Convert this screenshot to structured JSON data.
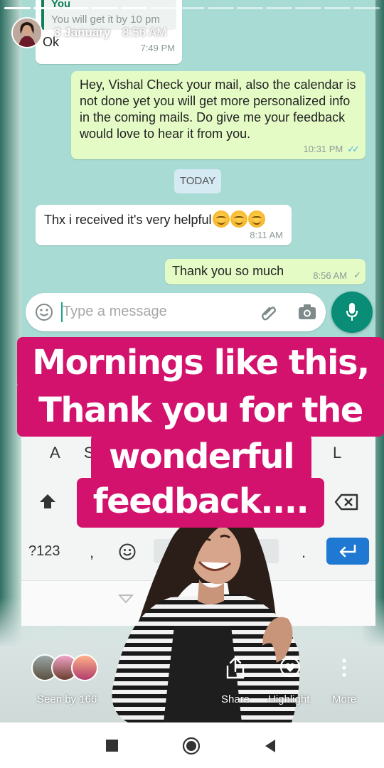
{
  "story": {
    "segments_total": 13,
    "segments_done": 5,
    "user_date": "3 January",
    "user_time": "8:56 AM"
  },
  "chat": {
    "top_sender": "You",
    "top_quote": "You will get it by 10 pm",
    "messages": [
      {
        "dir": "in",
        "text": "Ok",
        "time": "7:49 PM"
      },
      {
        "dir": "out",
        "text": "Hey, Vishal Check your mail, also the calendar is not done yet you will get more personalized info in the coming mails. Do give me your feedback would love to hear it from you.",
        "time": "10:31 PM",
        "status": "read"
      },
      {
        "dir": "in",
        "text": "Thx i received it's very helpful",
        "time": "8:11 AM",
        "emoji_count": 3
      },
      {
        "dir": "out",
        "text": "Thank you so much",
        "time": "8:56 AM",
        "status": "sent"
      }
    ],
    "day_chip": "TODAY",
    "input_placeholder": "Type a message",
    "icons": {
      "emoji": "emoji-icon",
      "attach": "paperclip-icon",
      "camera": "camera-icon",
      "mic": "microphone-icon"
    }
  },
  "keyboard": {
    "row_keys": [
      "A",
      "S",
      "L"
    ],
    "symbols_key": "?123",
    "comma_key": ",",
    "period_key": "."
  },
  "captions": {
    "line1": "Mornings like this,",
    "line2": "Thank you for the",
    "line3": "wonderful",
    "line4": "feedback...."
  },
  "footer": {
    "seen_by": "Seen by 166",
    "share": "Share",
    "highlight": "Highlight",
    "more": "More"
  },
  "colors": {
    "caption_bg": "#d3126d",
    "chat_bg": "#a7dbd3",
    "outgoing_bubble": "#e4fbc6",
    "mic_button": "#0a8d76",
    "read_ticks": "#4fb6ec"
  }
}
